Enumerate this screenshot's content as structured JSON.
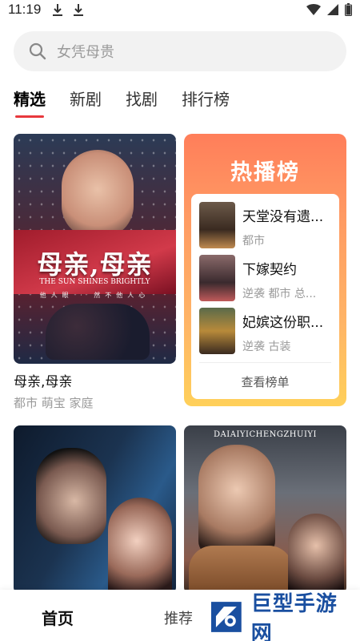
{
  "status": {
    "time": "11:19"
  },
  "search": {
    "placeholder": "女凭母贵"
  },
  "tabs": [
    {
      "label": "精选",
      "active": true
    },
    {
      "label": "新剧",
      "active": false
    },
    {
      "label": "找剧",
      "active": false
    },
    {
      "label": "排行榜",
      "active": false
    }
  ],
  "featured": {
    "poster_title": "母亲,母亲",
    "poster_subtitle": "THE SUN SHINES BRIGHTLY",
    "poster_tagline": "他人眼 · 然不他人心",
    "title": "母亲,母亲",
    "tags": "都市 萌宝 家庭"
  },
  "hot_list": {
    "title": "热播榜",
    "items": [
      {
        "name": "天堂没有遗...",
        "tags": "都市"
      },
      {
        "name": "下嫁契约",
        "tags": "逆袭 都市 总..."
      },
      {
        "name": "妃嫔这份职...",
        "tags": "逆袭 古装"
      }
    ],
    "more_label": "查看榜单"
  },
  "poster4_text": "DAIAIYICHENGZHUIYI",
  "bottom_nav": {
    "home": "首页",
    "recommend": "推荐"
  },
  "watermark": {
    "text": "巨型手游网"
  },
  "colors": {
    "tab_underline": "#e8383d",
    "hot_gradient_top": "#ff7e5a",
    "hot_gradient_bottom": "#ffd05a",
    "watermark_blue": "#1a4fa0"
  }
}
